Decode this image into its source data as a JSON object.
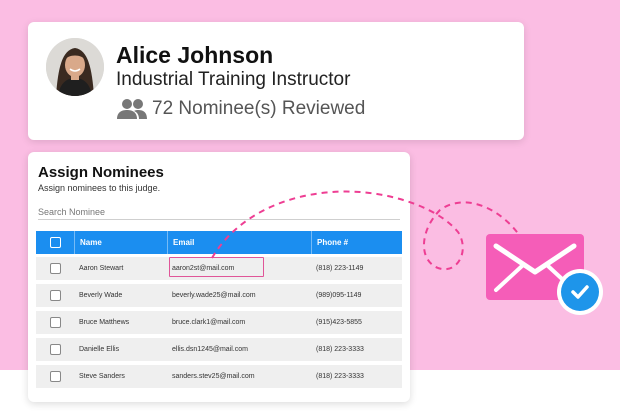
{
  "profile": {
    "name": "Alice Johnson",
    "role": "Industrial Training Instructor",
    "reviewed": "72 Nominee(s) Reviewed"
  },
  "assign": {
    "title": "Assign Nominees",
    "subtitle": "Assign nominees to this judge.",
    "search_placeholder": "Search Nominee",
    "columns": [
      "Name",
      "Email",
      "Phone #"
    ],
    "rows": [
      {
        "name": "Aaron Stewart",
        "email": "aaron2st@mail.com",
        "phone": "(818) 223-1149"
      },
      {
        "name": "Beverly Wade",
        "email": "beverly.wade25@mail.com",
        "phone": "(989)095-1149"
      },
      {
        "name": "Bruce Matthews",
        "email": "bruce.clark1@mail.com",
        "phone": "(915)423-5855"
      },
      {
        "name": "Danielle Ellis",
        "email": "ellis.dsn1245@mail.com",
        "phone": "(818) 223-3333"
      },
      {
        "name": "Steve Sanders",
        "email": "sanders.stev25@mail.com",
        "phone": "(818) 223-3333"
      }
    ]
  },
  "colors": {
    "background": "#fbbde3",
    "header": "#1b8ef0",
    "envelope": "#f55db8",
    "badge": "#1e95ea",
    "highlight": "#e05598"
  },
  "icons": [
    "people-icon",
    "envelope-icon",
    "check-icon",
    "avatar"
  ]
}
